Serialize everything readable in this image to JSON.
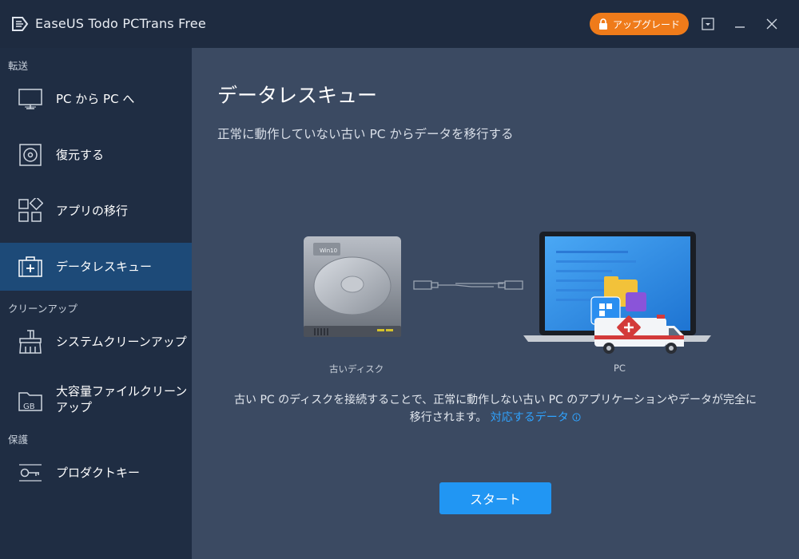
{
  "window": {
    "title": "EaseUS Todo PCTrans Free",
    "upgrade_label": "アップグレード"
  },
  "sidebar": {
    "sections": [
      {
        "label": "転送"
      },
      {
        "label": "クリーンアップ"
      },
      {
        "label": "保護"
      }
    ],
    "items": [
      {
        "label": "PC から PC へ",
        "icon": "monitor-icon"
      },
      {
        "label": "復元する",
        "icon": "disc-icon"
      },
      {
        "label": "アプリの移行",
        "icon": "apps-icon"
      },
      {
        "label": "データレスキュー",
        "icon": "first-aid-kit-icon",
        "active": true
      },
      {
        "label": "システムクリーンアップ",
        "icon": "broom-icon"
      },
      {
        "label": "大容量ファイルクリーンアップ",
        "icon": "gb-folder-icon",
        "badge": "GB"
      },
      {
        "label": "プロダクトキー",
        "icon": "key-icon"
      }
    ]
  },
  "main": {
    "title": "データレスキュー",
    "subtitle": "正常に動作していない古い PC からデータを移行する",
    "disk_caption": "古いディスク",
    "pc_caption": "PC",
    "disk_badge": "Win10",
    "description_part1": "古い PC のディスクを接続することで、正常に動作しない古い PC のアプリケーションやデータが完全に",
    "description_part2": "移行されます。",
    "supported_data_link": "対応するデータ",
    "start_label": "スタート"
  },
  "colors": {
    "accent": "#2196f3",
    "upgrade": "#ef7b1a",
    "sidebar_active": "#1d4a78",
    "link": "#2fa3ff"
  }
}
